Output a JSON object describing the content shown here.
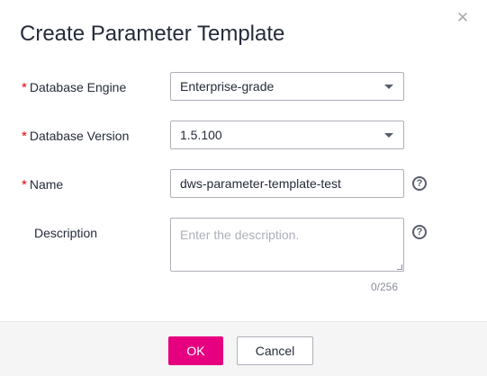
{
  "dialog": {
    "title": "Create Parameter Template",
    "close_icon": "close-icon"
  },
  "form": {
    "engine": {
      "label": "Database Engine",
      "value": "Enterprise-grade",
      "required": true
    },
    "version": {
      "label": "Database Version",
      "value": "1.5.100",
      "required": true
    },
    "name": {
      "label": "Name",
      "value": "dws-parameter-template-test",
      "required": true
    },
    "description": {
      "label": "Description",
      "value": "",
      "placeholder": "Enter the description.",
      "counter": "0/256",
      "required": false
    },
    "required_marker": "*"
  },
  "footer": {
    "ok_label": "OK",
    "cancel_label": "Cancel"
  },
  "colors": {
    "primary": "#e6007f",
    "required": "#e60000"
  }
}
